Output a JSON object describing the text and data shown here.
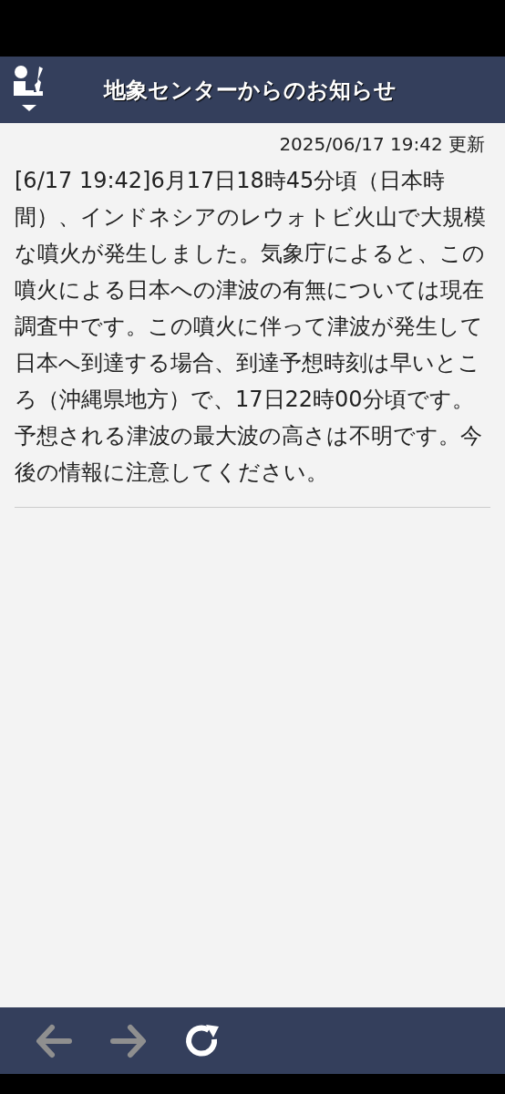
{
  "header": {
    "title": "地象センターからのお知らせ"
  },
  "notice": {
    "updated": "2025/06/17 19:42 更新",
    "body": "[6/17 19:42]6月17日18時45分頃（日本時間）、インドネシアのレウォトビ火山で大規模な噴火が発生しました。気象庁によると、この噴火による日本への津波の有無については現在調査中です。この噴火に伴って津波が発生して日本へ到達する場合、到達予想時刻は早いところ（沖縄県地方）で、17日22時00分頃です。予想される津波の最大波の高さは不明です。今後の情報に注意してください。"
  },
  "toolbar": [
    {
      "kind": "back",
      "disabled": true
    },
    {
      "kind": "forward",
      "disabled": true
    },
    {
      "kind": "reload",
      "disabled": false
    }
  ]
}
